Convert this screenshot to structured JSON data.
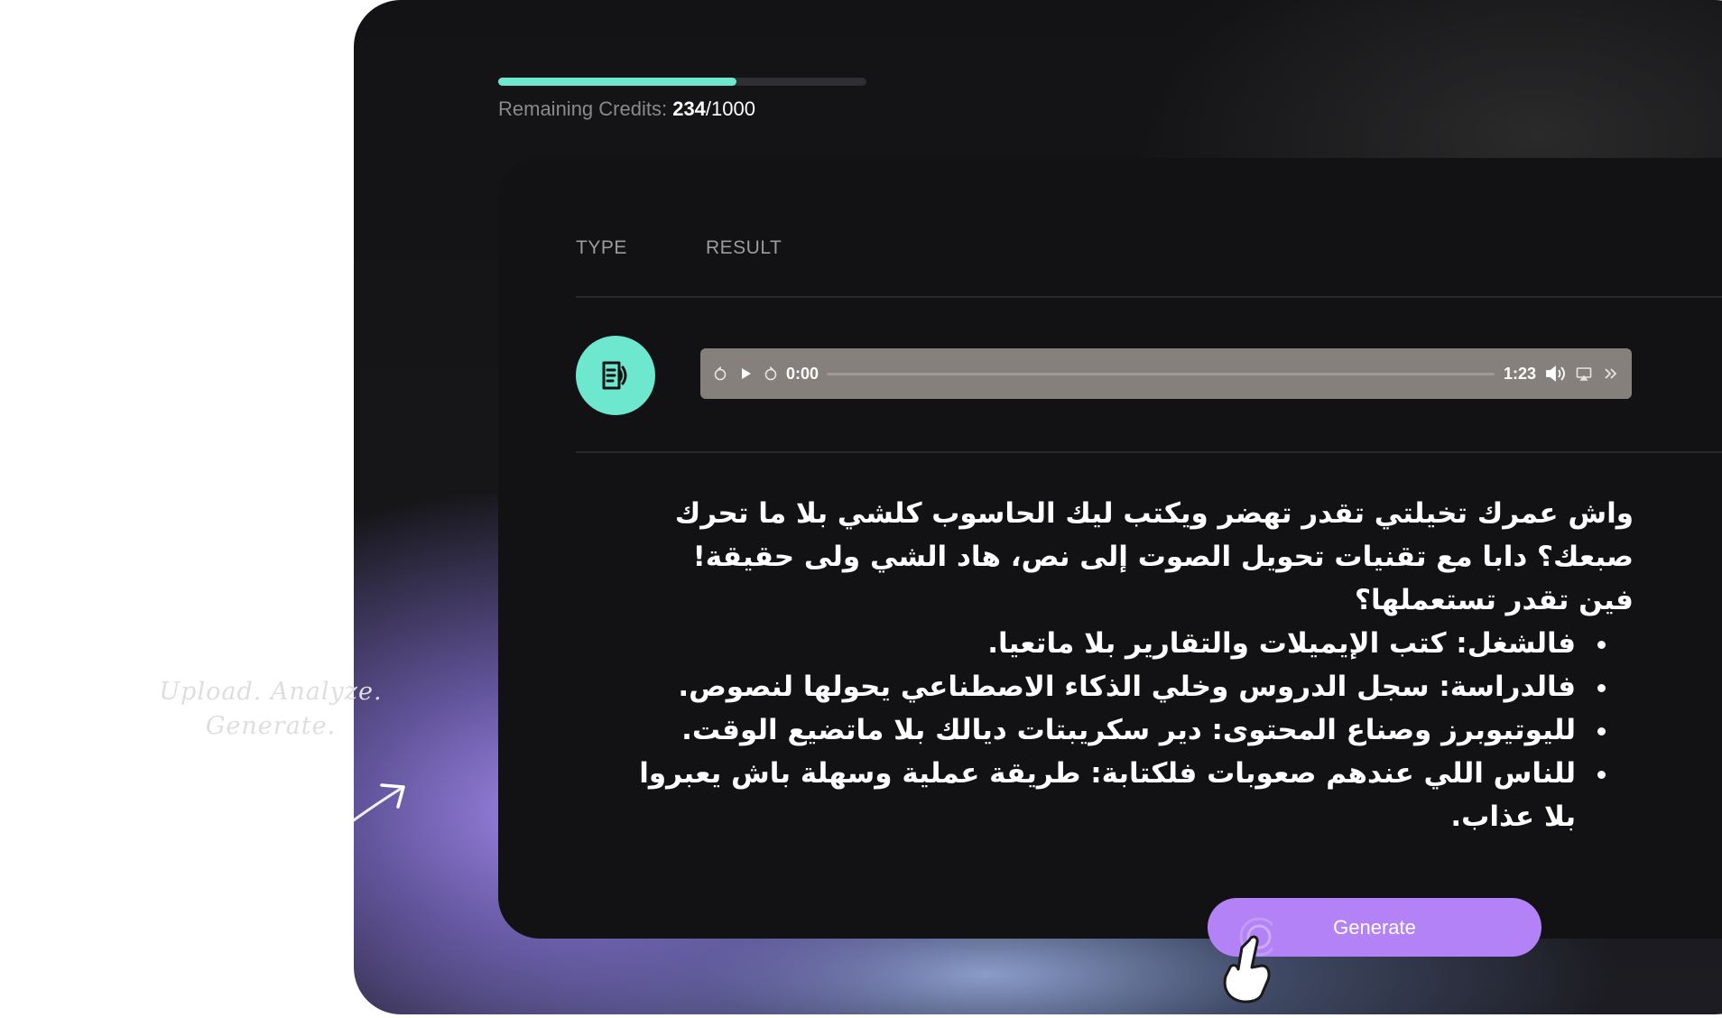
{
  "credits": {
    "label": "Remaining Credits:",
    "used": "234",
    "total": "/1000",
    "progress_fraction": 0.646
  },
  "tabs": [
    {
      "label": "TYPE"
    },
    {
      "label": "RESULT"
    }
  ],
  "file_icon": "document-audio-icon",
  "audio_player": {
    "current_time": "0:00",
    "duration": "1:23",
    "icons": [
      "rewind-icon",
      "play-icon",
      "forward-icon",
      "volume-icon",
      "cast-icon",
      "more-icon"
    ]
  },
  "transcript": {
    "paragraphs": [
      "واش عمرك تخيلتي تقدر تهضر ويكتب ليك الحاسوب كلشي بلا ما تحرك صبعك؟ دابا مع تقنيات تحويل الصوت إلى نص، هاد الشي ولى حقيقة!",
      "فين تقدر تستعملها؟"
    ],
    "bullets": [
      "فالشغل: كتب الإيميلات والتقارير بلا ماتعيا.",
      "فالدراسة: سجل الدروس وخلي الذكاء الاصطناعي يحولها لنصوص.",
      "لليوتيوبرز وصناع المحتوى: دير سكريبتات ديالك بلا ماتضيع الوقت.",
      "للناس اللي عندهم صعوبات فلكتابة: طريقة عملية وسهلة باش يعبروا بلا عذاب."
    ]
  },
  "generate_button": {
    "label": "Generate"
  },
  "tagline": {
    "line1": "Upload. Analyze.",
    "line2": "Generate."
  },
  "colors": {
    "accent_teal": "#6ee7cf",
    "accent_purple": "#b382f6",
    "panel_bg": "#131315"
  }
}
